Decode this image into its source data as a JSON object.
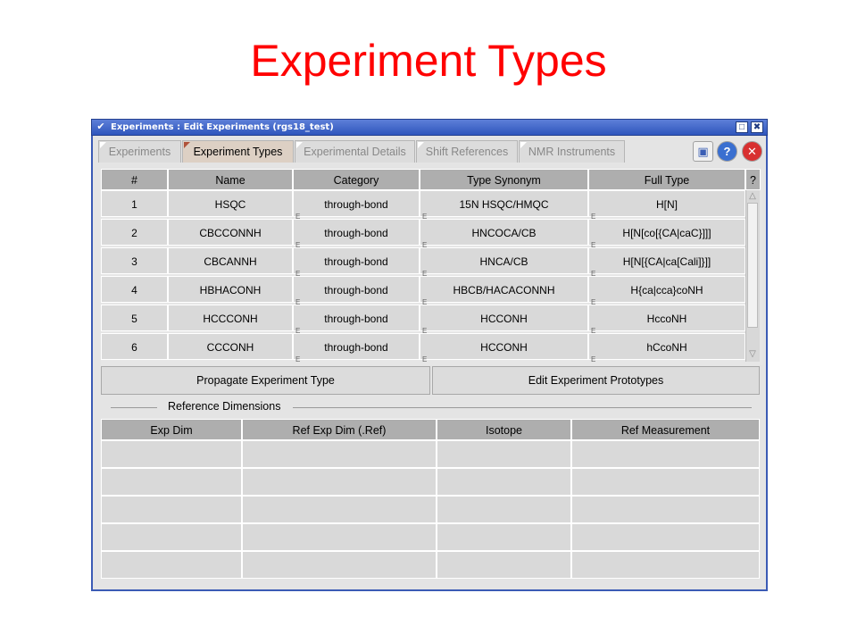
{
  "slide": {
    "title": "Experiment Types"
  },
  "window": {
    "title": "Experiments : Edit Experiments (rgs18_test)",
    "menu_glyph": "✔",
    "maximize_glyph": "□",
    "close_glyph": "✖"
  },
  "tabs": [
    {
      "label": "Experiments",
      "active": false
    },
    {
      "label": "Experiment Types",
      "active": true
    },
    {
      "label": "Experimental Details",
      "active": false
    },
    {
      "label": "Shift References",
      "active": false
    },
    {
      "label": "NMR Instruments",
      "active": false
    }
  ],
  "header_icons": {
    "windows": "▣",
    "help": "?",
    "close": "✕"
  },
  "types_table": {
    "columns": [
      "#",
      "Name",
      "Category",
      "Type Synonym",
      "Full Type"
    ],
    "corner_help": "?",
    "rows": [
      [
        "1",
        "HSQC",
        "through-bond",
        "15N HSQC/HMQC",
        "H[N]"
      ],
      [
        "2",
        "CBCCONNH",
        "through-bond",
        "HNCOCA/CB",
        "H[N[co[{CA|caC}]]]"
      ],
      [
        "3",
        "CBCANNH",
        "through-bond",
        "HNCA/CB",
        "H[N[{CA|ca[Cali]}]]"
      ],
      [
        "4",
        "HBHACONH",
        "through-bond",
        "HBCB/HACACONNH",
        "H{ca|cca}coNH"
      ],
      [
        "5",
        "HCCCONH",
        "through-bond",
        "HCCONH",
        "HccoNH"
      ],
      [
        "6",
        "CCCONH",
        "through-bond",
        "HCCONH",
        "hCcoNH"
      ]
    ],
    "edit_marker": "E"
  },
  "buttons": {
    "propagate": "Propagate Experiment Type",
    "edit_prototypes": "Edit Experiment Prototypes"
  },
  "reference_dimensions": {
    "label": "Reference Dimensions",
    "columns": [
      "Exp Dim",
      "Ref Exp Dim (.Ref)",
      "Isotope",
      "Ref Measurement"
    ],
    "empty_rows": 5
  },
  "colors": {
    "slide_title": "#ff0000",
    "titlebar": "#2f56bd",
    "active_tab": "#ddd0c4",
    "header_cell": "#aeaeae",
    "data_cell": "#d9d9d9"
  }
}
